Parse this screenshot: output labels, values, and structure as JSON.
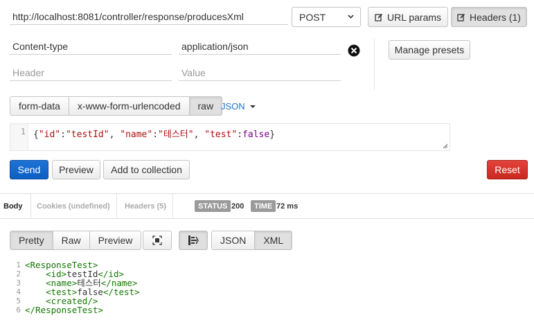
{
  "request": {
    "url": "http://localhost:8081/controller/response/producesXml",
    "method": "POST",
    "url_params_label": "URL params",
    "headers_label": "Headers (1)",
    "manage_presets_label": "Manage presets"
  },
  "headers": {
    "rows": [
      {
        "name": "Content-type",
        "value": "application/json"
      }
    ],
    "new_name_placeholder": "Header",
    "new_value_placeholder": "Value"
  },
  "body_types": [
    "form-data",
    "x-www-form-urlencoded",
    "raw"
  ],
  "body_type_active": "raw",
  "raw_format": "JSON",
  "editor": {
    "line_number": "1",
    "code": "{\"id\":\"testId\", \"name\":\"테스터\", \"test\":false}"
  },
  "actions": {
    "send": "Send",
    "preview": "Preview",
    "add_to_collection": "Add to collection",
    "reset": "Reset"
  },
  "response": {
    "tabs": [
      "Body",
      "Cookies (undefined)",
      "Headers (5)"
    ],
    "status_label": "STATUS",
    "status_value": "200",
    "time_label": "TIME",
    "time_value": "72 ms",
    "view_modes": [
      "Pretty",
      "Raw",
      "Preview"
    ],
    "formats": [
      "JSON",
      "XML"
    ],
    "format_active": "XML",
    "body_lines": [
      "<ResponseTest>",
      "    <id>testId</id>",
      "    <name>테스터</name>",
      "    <test>false</test>",
      "    <created/>",
      "</ResponseTest>"
    ]
  },
  "colors": {
    "send": "#0b5fc2",
    "reset": "#d9302a",
    "xml_tag": "#117700",
    "badge": "#9a9a9a"
  }
}
